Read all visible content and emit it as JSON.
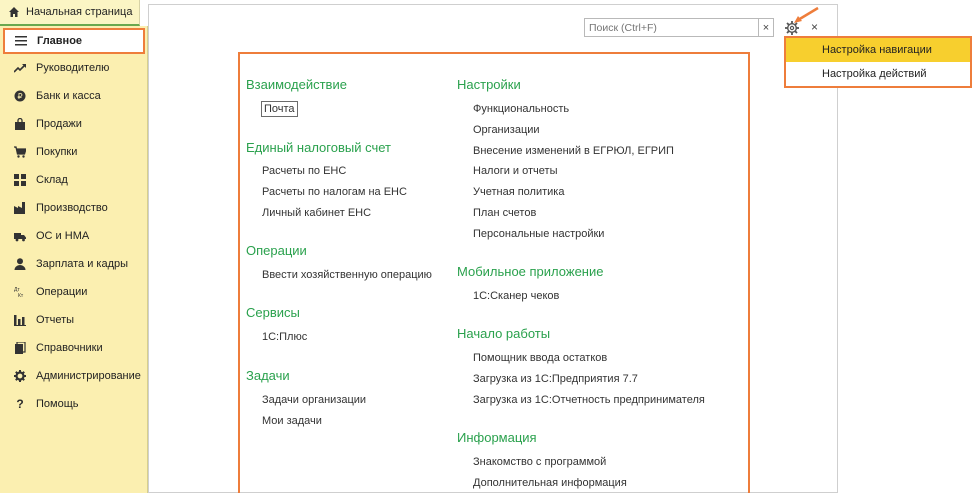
{
  "top_tab": {
    "label": "Начальная страница"
  },
  "sidebar": {
    "items": [
      {
        "label": "Главное",
        "icon": "menu-icon"
      },
      {
        "label": "Руководителю",
        "icon": "trend-icon"
      },
      {
        "label": "Банк и касса",
        "icon": "coin-icon"
      },
      {
        "label": "Продажи",
        "icon": "bag-icon"
      },
      {
        "label": "Покупки",
        "icon": "cart-icon"
      },
      {
        "label": "Склад",
        "icon": "grid-icon"
      },
      {
        "label": "Производство",
        "icon": "factory-icon"
      },
      {
        "label": "ОС и НМА",
        "icon": "truck-icon"
      },
      {
        "label": "Зарплата и кадры",
        "icon": "person-icon"
      },
      {
        "label": "Операции",
        "icon": "dt-kt-icon"
      },
      {
        "label": "Отчеты",
        "icon": "bar-chart-icon"
      },
      {
        "label": "Справочники",
        "icon": "book-icon"
      },
      {
        "label": "Администрирование",
        "icon": "gear-icon"
      },
      {
        "label": "Помощь",
        "icon": "question-icon"
      }
    ]
  },
  "search": {
    "placeholder": "Поиск (Ctrl+F)",
    "clear": "×"
  },
  "close": "×",
  "settings_menu": {
    "items": [
      "Настройка навигации",
      "Настройка действий"
    ]
  },
  "left_column": [
    {
      "title": "Взаимодействие",
      "links": [
        "Почта"
      ]
    },
    {
      "title": "Единый налоговый счет",
      "links": [
        "Расчеты по ЕНС",
        "Расчеты по налогам на ЕНС",
        "Личный кабинет ЕНС"
      ]
    },
    {
      "title": "Операции",
      "links": [
        "Ввести хозяйственную операцию"
      ]
    },
    {
      "title": "Сервисы",
      "links": [
        "1С:Плюс"
      ]
    },
    {
      "title": "Задачи",
      "links": [
        "Задачи организации",
        "Мои задачи"
      ]
    }
  ],
  "right_column": [
    {
      "title": "Настройки",
      "links": [
        "Функциональность",
        "Организации",
        "Внесение изменений в ЕГРЮЛ, ЕГРИП",
        "Налоги и отчеты",
        "Учетная политика",
        "План счетов",
        "Персональные настройки"
      ]
    },
    {
      "title": "Мобильное приложение",
      "links": [
        "1С:Сканер чеков"
      ]
    },
    {
      "title": "Начало работы",
      "links": [
        "Помощник ввода остатков",
        "Загрузка из 1С:Предприятия 7.7",
        "Загрузка из 1С:Отчетность предпринимателя"
      ]
    },
    {
      "title": "Информация",
      "links": [
        "Знакомство с программой",
        "Дополнительная информация"
      ]
    }
  ],
  "colors": {
    "accent": "#ee7d3b",
    "section": "#2aa14d",
    "sidebar": "#fbefb0",
    "highlight": "#f7cf2e"
  }
}
